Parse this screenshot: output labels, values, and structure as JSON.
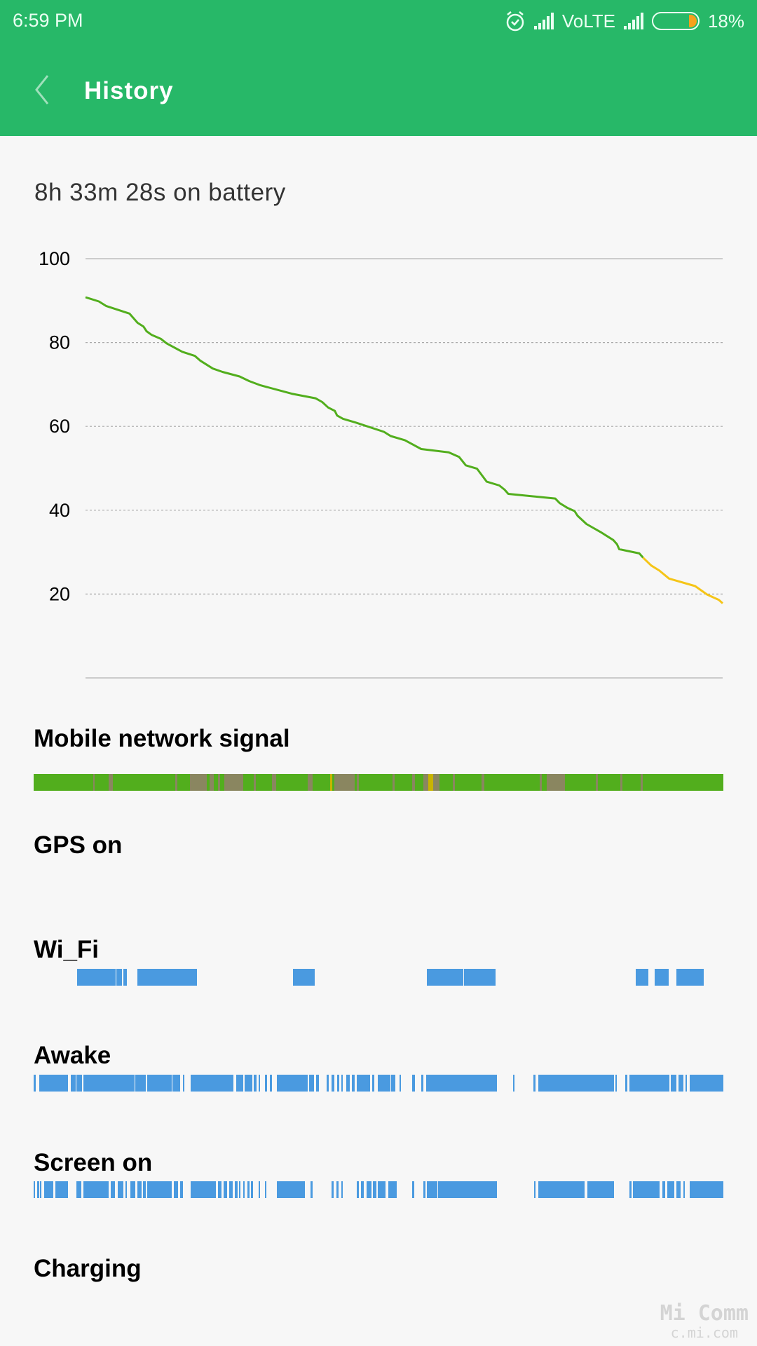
{
  "status_bar": {
    "time": "6:59 PM",
    "icons": [
      "alarm-icon",
      "signal-icon",
      "signal-icon",
      "battery-icon"
    ],
    "network_label": "VoLTE",
    "battery_percent": "18%",
    "battery_level": 18,
    "battery_color": "#f7a11d"
  },
  "header": {
    "back_icon": "chevron-left-icon",
    "title": "History",
    "color": "#27b868"
  },
  "summary": "8h 33m 28s on battery",
  "chart_data": {
    "type": "line",
    "title": "",
    "xlabel": "",
    "ylabel": "",
    "x_unit": "hours on battery",
    "xlim": [
      0,
      8.56
    ],
    "ylim": [
      0,
      100
    ],
    "yticks": [
      "100",
      "80",
      "60",
      "40",
      "20"
    ],
    "ytick_values": [
      100,
      80,
      60,
      40,
      20
    ],
    "grid": "dotted horizontal",
    "line_colors": {
      "normal": "#52ae1d",
      "low": "#f5c518"
    },
    "low_from_x": 7.49,
    "x": [
      0,
      0.18,
      0.28,
      0.59,
      0.7,
      0.78,
      0.82,
      0.89,
      1.01,
      1.09,
      1.3,
      1.47,
      1.54,
      1.71,
      1.84,
      2.07,
      2.2,
      2.35,
      2.77,
      3.09,
      3.18,
      3.26,
      3.35,
      3.38,
      3.46,
      3.65,
      4.01,
      4.1,
      4.29,
      4.51,
      4.88,
      5.02,
      5.11,
      5.26,
      5.39,
      5.56,
      5.63,
      5.68,
      6.31,
      6.37,
      6.47,
      6.57,
      6.61,
      6.73,
      6.92,
      7.09,
      7.14,
      7.17,
      7.44,
      7.49,
      7.6,
      7.71,
      7.84,
      8.19,
      8.35,
      8.51,
      8.56
    ],
    "y": [
      90.8,
      89.8,
      88.7,
      86.9,
      84.7,
      83.8,
      82.7,
      81.8,
      80.9,
      79.8,
      77.8,
      76.8,
      75.7,
      73.8,
      73.0,
      71.9,
      70.8,
      69.8,
      67.8,
      66.7,
      65.8,
      64.5,
      63.7,
      62.6,
      61.8,
      60.8,
      58.7,
      57.7,
      56.7,
      54.6,
      53.8,
      52.7,
      50.7,
      49.9,
      46.8,
      45.9,
      44.9,
      43.9,
      42.8,
      41.7,
      40.6,
      39.8,
      38.7,
      36.7,
      34.8,
      32.9,
      31.9,
      30.7,
      29.7,
      28.7,
      26.8,
      25.6,
      23.7,
      21.9,
      19.9,
      18.6,
      17.8
    ]
  },
  "timelines": {
    "mobile_signal": {
      "label": "Mobile network signal",
      "base_color": "#52ae1d",
      "weak_color": "#8a8660",
      "poor_color": "#c8b400",
      "weak": [
        [
          0.74,
          0.75
        ],
        [
          0.93,
          0.98
        ],
        [
          1.76,
          1.78
        ],
        [
          1.94,
          2.15
        ],
        [
          2.18,
          2.24
        ],
        [
          2.29,
          2.31
        ],
        [
          2.37,
          2.6
        ],
        [
          2.73,
          2.76
        ],
        [
          2.96,
          3.01
        ],
        [
          3.4,
          3.46
        ],
        [
          3.73,
          3.98
        ],
        [
          4.01,
          4.04
        ],
        [
          4.45,
          4.48
        ],
        [
          4.7,
          4.73
        ],
        [
          4.84,
          5.04
        ],
        [
          5.2,
          5.23
        ],
        [
          5.56,
          5.59
        ],
        [
          6.28,
          6.31
        ],
        [
          6.37,
          6.59
        ],
        [
          6.98,
          7.0
        ],
        [
          7.28,
          7.31
        ],
        [
          7.53,
          7.56
        ]
      ],
      "poor": [
        [
          3.68,
          3.71
        ],
        [
          4.9,
          4.96
        ]
      ]
    },
    "gps": {
      "label": "GPS on",
      "segments": []
    },
    "wifi": {
      "label": "Wi_Fi",
      "color": "#4a9ae0",
      "segments": [
        [
          0.54,
          1.02
        ],
        [
          1.03,
          1.1
        ],
        [
          1.11,
          1.16
        ],
        [
          1.29,
          2.03
        ],
        [
          3.22,
          3.49
        ],
        [
          4.88,
          5.33
        ],
        [
          5.34,
          5.73
        ],
        [
          7.47,
          7.63
        ],
        [
          7.71,
          7.88
        ],
        [
          7.98,
          8.32
        ]
      ]
    },
    "awake": {
      "label": "Awake",
      "color": "#4a9ae0",
      "segments": [
        [
          0,
          0.03
        ],
        [
          0.07,
          0.43
        ],
        [
          0.46,
          0.52
        ],
        [
          0.53,
          0.6
        ],
        [
          0.62,
          1.25
        ],
        [
          1.26,
          1.39
        ],
        [
          1.41,
          1.71
        ],
        [
          1.72,
          1.82
        ],
        [
          1.85,
          1.87
        ],
        [
          1.95,
          2.48
        ],
        [
          2.51,
          2.6
        ],
        [
          2.62,
          2.71
        ],
        [
          2.73,
          2.77
        ],
        [
          2.79,
          2.81
        ],
        [
          2.87,
          2.9
        ],
        [
          2.93,
          2.96
        ],
        [
          3.02,
          3.4
        ],
        [
          3.42,
          3.48
        ],
        [
          3.51,
          3.54
        ],
        [
          3.64,
          3.66
        ],
        [
          3.7,
          3.73
        ],
        [
          3.77,
          3.79
        ],
        [
          3.82,
          3.84
        ],
        [
          3.88,
          3.92
        ],
        [
          3.95,
          3.98
        ],
        [
          4.01,
          4.18
        ],
        [
          4.2,
          4.23
        ],
        [
          4.27,
          4.43
        ],
        [
          4.44,
          4.49
        ],
        [
          4.54,
          4.56
        ],
        [
          4.7,
          4.73
        ],
        [
          4.81,
          4.84
        ],
        [
          4.87,
          5.75
        ],
        [
          5.95,
          5.97
        ],
        [
          6.2,
          6.23
        ],
        [
          6.26,
          7.2
        ],
        [
          7.22,
          7.23
        ],
        [
          7.34,
          7.37
        ],
        [
          7.39,
          7.89
        ],
        [
          7.91,
          7.98
        ],
        [
          8.0,
          8.06
        ],
        [
          8.09,
          8.11
        ],
        [
          8.14,
          8.56
        ]
      ]
    },
    "screen_on": {
      "label": "Screen on",
      "color": "#4a9ae0",
      "segments": [
        [
          0,
          0.02
        ],
        [
          0.04,
          0.07
        ],
        [
          0.08,
          0.1
        ],
        [
          0.13,
          0.24
        ],
        [
          0.27,
          0.43
        ],
        [
          0.53,
          0.59
        ],
        [
          0.62,
          0.93
        ],
        [
          0.96,
          1.01
        ],
        [
          1.04,
          1.11
        ],
        [
          1.14,
          1.16
        ],
        [
          1.2,
          1.26
        ],
        [
          1.29,
          1.34
        ],
        [
          1.36,
          1.39
        ],
        [
          1.41,
          1.71
        ],
        [
          1.74,
          1.79
        ],
        [
          1.82,
          1.85
        ],
        [
          1.95,
          2.26
        ],
        [
          2.29,
          2.33
        ],
        [
          2.36,
          2.4
        ],
        [
          2.43,
          2.47
        ],
        [
          2.5,
          2.53
        ],
        [
          2.55,
          2.57
        ],
        [
          2.6,
          2.62
        ],
        [
          2.65,
          2.68
        ],
        [
          2.7,
          2.72
        ],
        [
          2.79,
          2.81
        ],
        [
          2.87,
          2.89
        ],
        [
          3.02,
          3.37
        ],
        [
          3.44,
          3.46
        ],
        [
          3.7,
          3.72
        ],
        [
          3.76,
          3.78
        ],
        [
          3.82,
          3.84
        ],
        [
          4.01,
          4.04
        ],
        [
          4.06,
          4.1
        ],
        [
          4.13,
          4.19
        ],
        [
          4.21,
          4.25
        ],
        [
          4.27,
          4.37
        ],
        [
          4.4,
          4.51
        ],
        [
          4.7,
          4.72
        ],
        [
          4.84,
          4.86
        ],
        [
          4.88,
          5.01
        ],
        [
          5.02,
          5.75
        ],
        [
          6.21,
          6.23
        ],
        [
          6.26,
          6.84
        ],
        [
          6.87,
          7.2
        ],
        [
          7.39,
          7.42
        ],
        [
          7.44,
          7.77
        ],
        [
          7.8,
          7.84
        ],
        [
          7.86,
          7.95
        ],
        [
          7.98,
          8.03
        ],
        [
          8.06,
          8.08
        ],
        [
          8.14,
          8.56
        ]
      ]
    },
    "charging": {
      "label": "Charging",
      "segments": []
    }
  },
  "watermark": {
    "line1": "Mi Comm",
    "line2": "c.mi.com"
  }
}
